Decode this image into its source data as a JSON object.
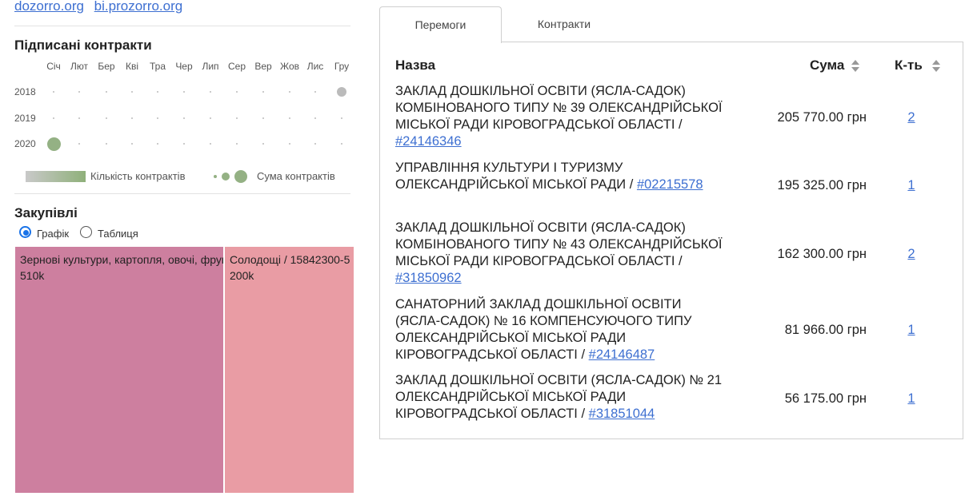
{
  "links": [
    {
      "label": "dozorro.org"
    },
    {
      "label": "bi.prozorro.org"
    }
  ],
  "signed": {
    "title": "Підписані контракти",
    "months": [
      "Січ",
      "Лют",
      "Бер",
      "Кві",
      "Тра",
      "Чер",
      "Лип",
      "Сер",
      "Вер",
      "Жов",
      "Лис",
      "Гру"
    ],
    "years": [
      {
        "label": "2018",
        "dots": [
          0,
          0,
          0,
          0,
          0,
          0,
          0,
          0,
          0,
          0,
          0,
          1
        ]
      },
      {
        "label": "2019",
        "dots": [
          0,
          0,
          0,
          0,
          0,
          0,
          0,
          0,
          0,
          0,
          0,
          0
        ]
      },
      {
        "label": "2020",
        "dots": [
          3,
          0,
          0,
          0,
          0,
          0,
          0,
          0,
          0,
          0,
          0,
          0
        ]
      }
    ],
    "legend_count": "Кількість контрактів",
    "legend_sum": "Сума контрактів",
    "colors": {
      "empty_dot": "#bbbbbb",
      "gray_dot": "#bbbbbb",
      "green_dot": "#94b184"
    }
  },
  "procurement": {
    "title": "Закупівлі",
    "view_options": [
      {
        "label": "Графік",
        "selected": true
      },
      {
        "label": "Таблиця",
        "selected": false
      }
    ],
    "tiles": [
      {
        "label": "Зернові культури, картопля, овочі, фрукти та горіхи",
        "value": "510k",
        "color": "#cd7f9f"
      },
      {
        "label": "Солодощі / 15842300-5",
        "value": "200k",
        "color": "#e99ca4"
      }
    ]
  },
  "tabs": [
    {
      "label": "Перемоги",
      "active": true
    },
    {
      "label": "Контракти",
      "active": false
    }
  ],
  "table": {
    "columns": {
      "name": "Назва",
      "sum": "Сума",
      "count": "К-ть"
    },
    "rows": [
      {
        "name": "ЗАКЛАД ДОШКІЛЬНОЇ ОСВІТИ (ЯСЛА-САДОК) КОМБІНОВАНОГО ТИПУ № 39 ОЛЕКСАНДРІЙСЬКОЇ МІСЬКОЇ РАДИ КІРОВОГРАДСЬКОЇ ОБЛАСТІ",
        "id": "#24146346",
        "sum": "205 770.00 грн",
        "count": "2"
      },
      {
        "name": "УПРАВЛІННЯ КУЛЬТУРИ І ТУРИЗМУ ОЛЕКСАНДРІЙСЬКОЇ МІСЬКОЇ РАДИ",
        "id": "#02215578",
        "sum": "195 325.00 грн",
        "count": "1"
      },
      {
        "name": "ЗАКЛАД ДОШКІЛЬНОЇ ОСВІТИ (ЯСЛА-САДОК) КОМБІНОВАНОГО ТИПУ № 43 ОЛЕКСАНДРІЙСЬКОЇ МІСЬКОЇ РАДИ КІРОВОГРАДСЬКОЇ ОБЛАСТІ",
        "id": "#31850962",
        "sum": "162 300.00 грн",
        "count": "2"
      },
      {
        "name": "САНАТОРНИЙ ЗАКЛАД ДОШКІЛЬНОЇ ОСВІТИ (ЯСЛА-САДОК) № 16 КОМПЕНСУЮЧОГО ТИПУ ОЛЕКСАНДРІЙСЬКОЇ МІСЬКОЇ РАДИ КІРОВОГРАДСЬКОЇ ОБЛАСТІ",
        "id": "#24146487",
        "sum": "81 966.00 грн",
        "count": "1"
      },
      {
        "name": "ЗАКЛАД ДОШКІЛЬНОЇ ОСВІТИ (ЯСЛА-САДОК) № 21 ОЛЕКСАНДРІЙСЬКОЇ МІСЬКОЇ РАДИ КІРОВОГРАДСЬКОЇ ОБЛАСТІ",
        "id": "#31851044",
        "sum": "56 175.00 грн",
        "count": "1"
      }
    ]
  }
}
